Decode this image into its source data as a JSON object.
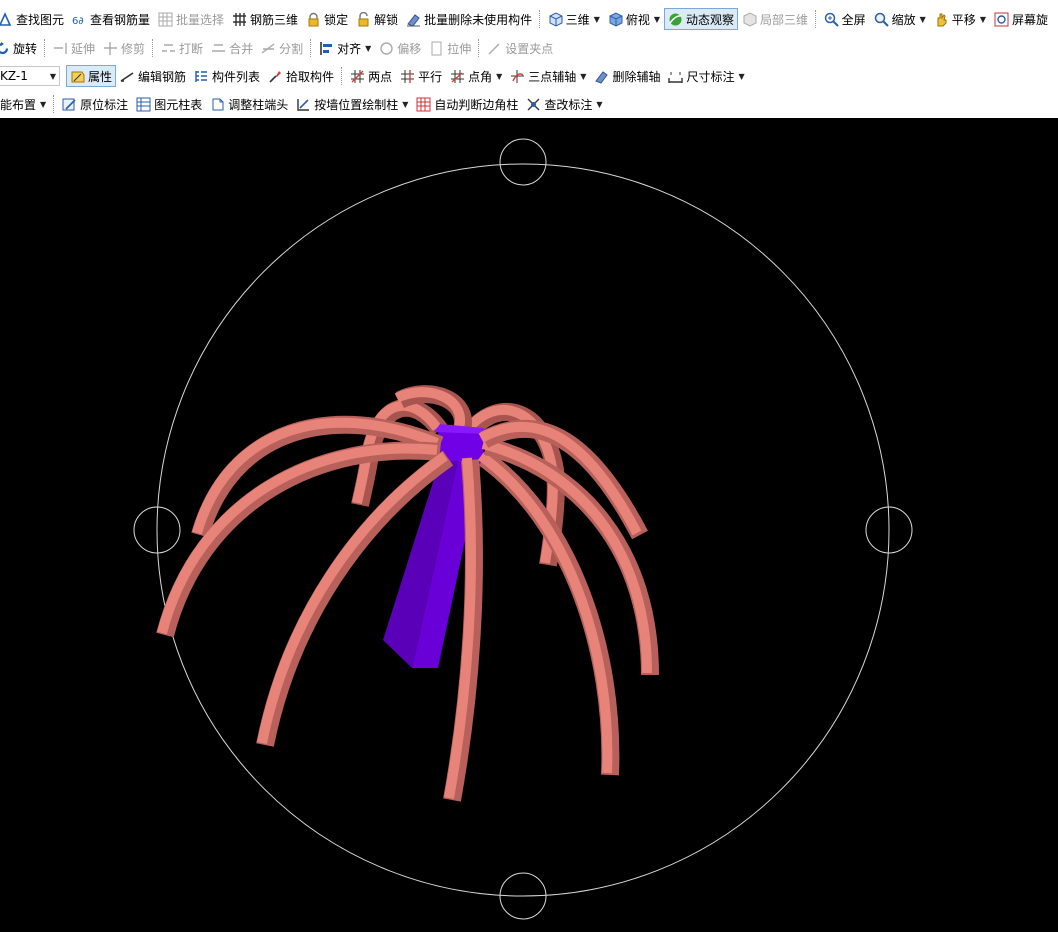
{
  "toolbar_row1": {
    "find_element": "查找图元",
    "view_rebar_qty": "查看钢筋量",
    "batch_select": "批量选择",
    "rebar_3d": "钢筋三维",
    "lock": "锁定",
    "unlock": "解锁",
    "batch_delete_unused": "批量删除未使用构件",
    "view_3d": "三维",
    "top_view": "俯视",
    "dynamic_observe": "动态观察",
    "local_3d": "局部三维",
    "fullscreen": "全屏",
    "zoom": "缩放",
    "pan": "平移",
    "screen_rotate": "屏幕旋"
  },
  "toolbar_row2": {
    "rotate": "旋转",
    "extend": "延伸",
    "trim": "修剪",
    "break": "打断",
    "merge": "合并",
    "split": "分割",
    "align": "对齐",
    "offset": "偏移",
    "stretch": "拉伸",
    "set_grip": "设置夹点"
  },
  "toolbar_row3": {
    "component_select": "KZ-1",
    "properties": "属性",
    "edit_rebar": "编辑钢筋",
    "component_list": "构件列表",
    "pick_component": "拾取构件",
    "two_points": "两点",
    "parallel": "平行",
    "point_angle": "点角",
    "three_point_axis": "三点辅轴",
    "delete_axis": "删除辅轴",
    "dimension": "尺寸标注"
  },
  "toolbar_row4": {
    "smart_layout": "能布置",
    "in_place_label": "原位标注",
    "element_column_table": "图元柱表",
    "adjust_column_end": "调整柱端头",
    "draw_column_by_wall": "按墙位置绘制柱",
    "auto_corner_column": "自动判断边角柱",
    "check_label": "查改标注"
  },
  "viewport": {
    "background": "#000000",
    "orbit_circle_color": "#d9d9d9",
    "column_color": "#6a00d8",
    "rebar_color": "#e8837a"
  }
}
